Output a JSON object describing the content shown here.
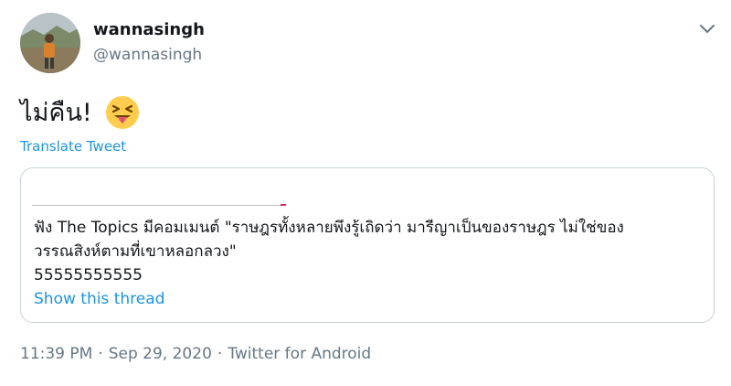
{
  "author": {
    "display_name": "wannasingh",
    "handle": "@wannasingh",
    "avatar_icon": "profile-photo-avatar"
  },
  "tweet": {
    "text": "ไม่คืน!",
    "emoji": "squinting-face-with-tongue",
    "translate_label": "Translate Tweet"
  },
  "quoted": {
    "line1": "ฟัง The Topics มีคอมเมนต์ \"ราษฎรทั้งหลายพึงรู้เถิดว่า มารีญาเป็นของราษฎร ไม่ใช่ของ",
    "line2": "วรรณสิงห์ตามที่เขาหลอกลวง\"",
    "line3": "55555555555",
    "show_thread_label": "Show this thread"
  },
  "meta": {
    "time": "11:39 PM",
    "date": "Sep 29, 2020",
    "source": "Twitter for Android",
    "separator": "·"
  },
  "colors": {
    "link": "#1b95e0",
    "secondary": "#657786",
    "text": "#14171a",
    "border": "#c9d3da"
  }
}
